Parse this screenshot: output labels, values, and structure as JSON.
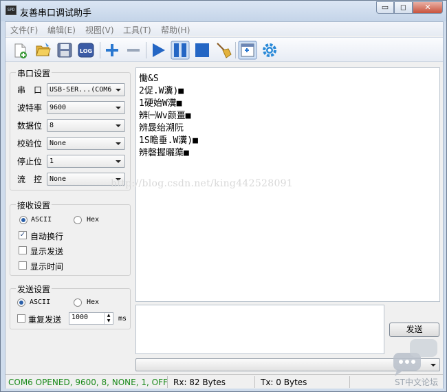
{
  "window": {
    "title": "友善串口调试助手",
    "icon_label": "SPD",
    "controls": {
      "minimize": "▭",
      "maximize": "◻",
      "close": "✕"
    }
  },
  "menu": [
    "文件(F)",
    "编辑(E)",
    "视图(V)",
    "工具(T)",
    "帮助(H)"
  ],
  "toolbar": {
    "icons": [
      "new-file-icon",
      "open-folder-icon",
      "save-icon",
      "log-icon",
      "add-icon",
      "remove-icon",
      "play-icon",
      "pause-icon",
      "stop-icon",
      "broom-clear-icon",
      "window-layout-icon",
      "settings-gear-icon"
    ],
    "log_label": "LOG"
  },
  "serial_settings": {
    "title": "串口设置",
    "fields": [
      {
        "label": "串　口",
        "value": "USB-SER...(COM6"
      },
      {
        "label": "波特率",
        "value": "9600"
      },
      {
        "label": "数据位",
        "value": "8"
      },
      {
        "label": "校验位",
        "value": "None"
      },
      {
        "label": "停止位",
        "value": "1"
      },
      {
        "label": "流　控",
        "value": "None"
      }
    ]
  },
  "receive_settings": {
    "title": "接收设置",
    "ascii": "ASCII",
    "hex": "Hex",
    "selected": "ASCII",
    "auto_wrap": "自动换行",
    "auto_wrap_checked": true,
    "show_send": "显示发送",
    "show_send_checked": false,
    "show_time": "显示时间",
    "show_time_checked": false
  },
  "send_settings": {
    "title": "发送设置",
    "ascii": "ASCII",
    "hex": "Hex",
    "selected": "ASCII",
    "repeat_send": "重复发送",
    "repeat_send_checked": false,
    "interval_value": "1000",
    "interval_unit": "ms"
  },
  "receive_area": {
    "lines": [
      "慟&S",
      "2促.W瀵)■",
      "1硬始W瀵■",
      "辨㈠Wv颜畺■",
      "辨晸绐溯阮",
      "1S瞻垂.W瀵)■",
      "辨磬握曬蕖■"
    ]
  },
  "watermark": "http://blog.csdn.net/king442528091",
  "send_button": "发送",
  "status": {
    "connection": "COM6 OPENED, 9600, 8, NONE, 1, OFF",
    "rx": "Rx: 82 Bytes",
    "tx": "Tx: 0 Bytes",
    "connection_color": "#1a8a1a"
  },
  "forum_logo": "ST中文论坛"
}
